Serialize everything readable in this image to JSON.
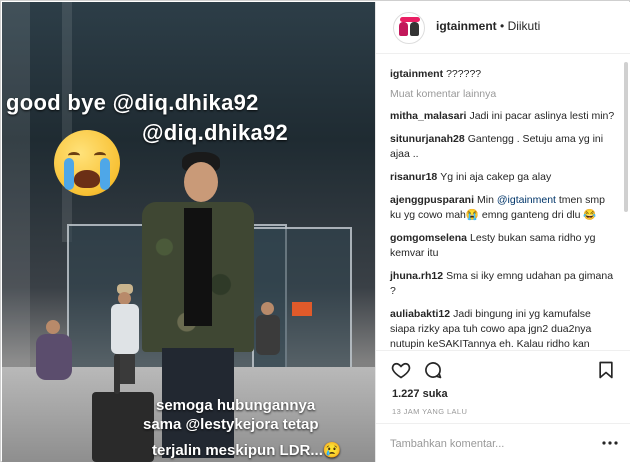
{
  "photo": {
    "caption_line1": "good bye @diq.dhika92",
    "caption_line2": "@diq.dhika92",
    "story_line1": "semoga hubungannya",
    "story_line2": "sama @lestykejora  tetap",
    "story_line3": "terjalin meskipun LDR...😢"
  },
  "header": {
    "username": "igtainment",
    "separator": "•",
    "follow_state": "Diikuti"
  },
  "caption": {
    "user": "igtainment",
    "text": "??????"
  },
  "load_more": "Muat komentar lainnya",
  "comments": [
    {
      "user": "mitha_malasari",
      "text": "Jadi ini pacar aslinya lesti min?"
    },
    {
      "user": "situnurjanah28",
      "text": "Gantengg . Setuju ama yg ini ajaa .."
    },
    {
      "user": "risanur18",
      "text": "Yg ini aja cakep ga alay"
    },
    {
      "user": "ajenggpusparani",
      "text_before": "Min",
      "mention": "@igtainment",
      "text_after": "tmen smp ku yg cowo mah😭 emng ganteng dri dlu 😂"
    },
    {
      "user": "gomgomselena",
      "text": "Lesty bukan sama ridho yg kemvar itu"
    },
    {
      "user": "jhuna.rh12",
      "text": "Sma si iky emng udahan pa gimana ?"
    },
    {
      "user": "auliabakti12",
      "text": "Jadi bingung ini yg kamufalse siapa rizky apa tuh cowo apa jgn2 dua2nya nutupin keSAKITannya eh. Kalau ridho kan"
    }
  ],
  "actions": {
    "like_icon": "heart-icon",
    "comment_icon": "comment-icon",
    "save_icon": "bookmark-icon"
  },
  "likes": "1.227 suka",
  "timestamp": "13 JAM YANG LALU",
  "add_comment": {
    "placeholder": "Tambahkan komentar...",
    "more_icon": "more-dots-icon"
  }
}
